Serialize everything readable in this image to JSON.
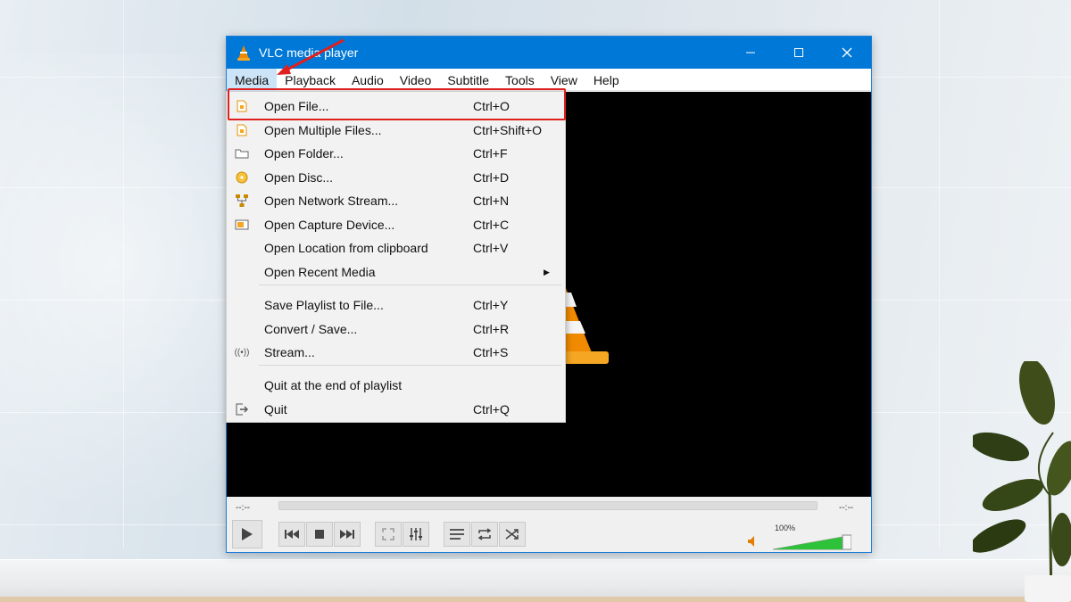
{
  "window": {
    "title": "VLC media player",
    "buttons": {
      "minimize": "—",
      "maximize": "☐",
      "close": "✕"
    }
  },
  "menubar": {
    "items": [
      "Media",
      "Playback",
      "Audio",
      "Video",
      "Subtitle",
      "Tools",
      "View",
      "Help"
    ],
    "active": "Media"
  },
  "media_menu": {
    "items": [
      {
        "label": "Open File...",
        "shortcut": "Ctrl+O",
        "icon": "file-icon"
      },
      {
        "label": "Open Multiple Files...",
        "shortcut": "Ctrl+Shift+O",
        "icon": "files-icon"
      },
      {
        "label": "Open Folder...",
        "shortcut": "Ctrl+F",
        "icon": "folder-icon"
      },
      {
        "label": "Open Disc...",
        "shortcut": "Ctrl+D",
        "icon": "disc-icon"
      },
      {
        "label": "Open Network Stream...",
        "shortcut": "Ctrl+N",
        "icon": "network-icon"
      },
      {
        "label": "Open Capture Device...",
        "shortcut": "Ctrl+C",
        "icon": "capture-icon"
      },
      {
        "label": "Open Location from clipboard",
        "shortcut": "Ctrl+V",
        "icon": ""
      },
      {
        "label": "Open Recent Media",
        "shortcut": "",
        "icon": "",
        "submenu": true
      },
      {
        "label": "Save Playlist to File...",
        "shortcut": "Ctrl+Y",
        "icon": ""
      },
      {
        "label": "Convert / Save...",
        "shortcut": "Ctrl+R",
        "icon": ""
      },
      {
        "label": "Stream...",
        "shortcut": "Ctrl+S",
        "icon": "stream-icon"
      },
      {
        "label": "Quit at the end of playlist",
        "shortcut": "",
        "icon": ""
      },
      {
        "label": "Quit",
        "shortcut": "Ctrl+Q",
        "icon": "quit-icon"
      }
    ]
  },
  "player": {
    "elapsed": "--:--",
    "remaining": "--:--",
    "volume_label": "100%",
    "volume_level": 1.0,
    "progress": 0
  },
  "colors": {
    "titlebar": "#0078d7",
    "highlight_box": "#e0201f",
    "volume_fill": "#2ec23a",
    "cone_orange": "#f08a00"
  }
}
